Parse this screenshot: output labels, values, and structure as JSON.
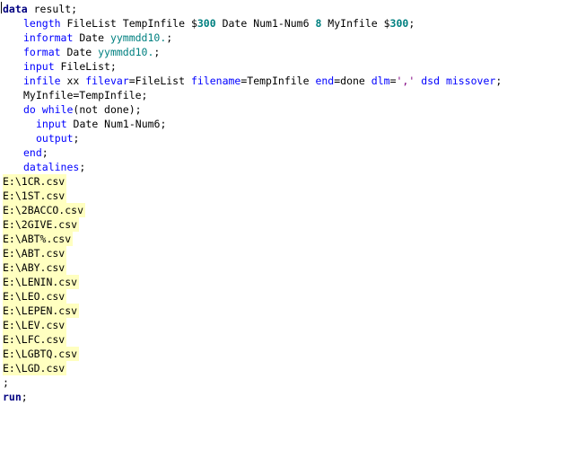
{
  "editor": {
    "code": {
      "l1_kw": "data",
      "l1_rest": " result;",
      "l2_kw": "length",
      "l2_a": " FileList TempInfile $",
      "l2_n1": "300",
      "l2_b": " Date Num1-Num6 ",
      "l2_n2": "8",
      "l2_c": " MyInfile $",
      "l2_n3": "300",
      "l2_d": ";",
      "l3_kw": "informat",
      "l3_a": " Date ",
      "l3_fmt": "yymmdd10.",
      "l3_b": ";",
      "l4_kw": "format",
      "l4_a": " Date ",
      "l4_fmt": "yymmdd10.",
      "l4_b": ";",
      "l5_kw": "input",
      "l5_a": " FileList;",
      "l6_kw1": "infile",
      "l6_a": " xx ",
      "l6_kw2": "filevar",
      "l6_b": "=FileList ",
      "l6_kw3": "filename",
      "l6_c": "=TempInfile ",
      "l6_kw4": "end",
      "l6_d": "=done ",
      "l6_kw5": "dlm",
      "l6_e": "=",
      "l6_str": "','",
      "l6_f": " ",
      "l6_kw6": "dsd",
      "l6_g": " ",
      "l6_kw7": "missover",
      "l6_h": ";",
      "l7": "MyInfile=TempInfile;",
      "l8_kw1": "do",
      "l8_a": " ",
      "l8_kw2": "while",
      "l8_b": "(not done);",
      "l9_kw": "input",
      "l9_a": " Date Num1-Num6;",
      "l10_kw": "output",
      "l10_a": ";",
      "l11_kw": "end",
      "l11_a": ";",
      "l12_kw": "datalines",
      "l12_a": ";",
      "datalines": [
        "E:\\1CR.csv",
        "E:\\1ST.csv",
        "E:\\2BACCO.csv",
        "E:\\2GIVE.csv",
        "E:\\ABT%.csv",
        "E:\\ABT.csv",
        "E:\\ABY.csv",
        "E:\\LENIN.csv",
        "E:\\LEO.csv",
        "E:\\LEPEN.csv",
        "E:\\LEV.csv",
        "E:\\LFC.csv",
        "E:\\LGBTQ.csv",
        "E:\\LGD.csv"
      ],
      "terminator": ";",
      "run_kw": "run",
      "run_a": ";"
    }
  }
}
